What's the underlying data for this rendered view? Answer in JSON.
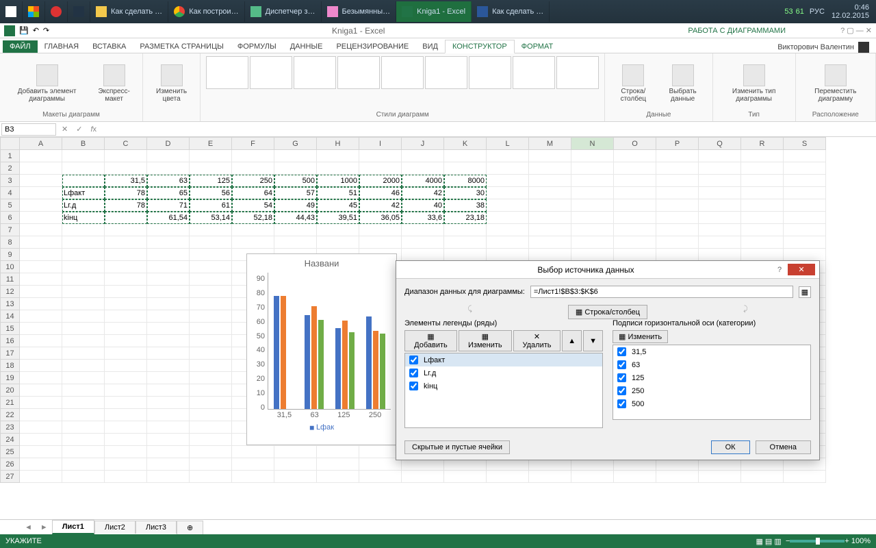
{
  "taskbar": {
    "items": [
      {
        "label": "",
        "icon": "start"
      },
      {
        "label": "",
        "icon": "apps"
      },
      {
        "label": "",
        "icon": "opera"
      },
      {
        "label": "",
        "icon": "xmplay"
      },
      {
        "label": "Как сделать …",
        "icon": "folder"
      },
      {
        "label": "Как построи…",
        "icon": "chrome"
      },
      {
        "label": "Диспетчер з…",
        "icon": "taskmgr"
      },
      {
        "label": "Безымянны…",
        "icon": "paint"
      },
      {
        "label": "Kniga1 - Excel",
        "icon": "excel",
        "active": true
      },
      {
        "label": "Как сделать …",
        "icon": "word"
      }
    ],
    "tray": {
      "battery": "53",
      "signal": "61",
      "lang": "РУС",
      "time": "0:46",
      "date": "12.02.2015"
    }
  },
  "qat": {
    "title": "Kniga1 - Excel",
    "context": "РАБОТА С ДИАГРАММАМИ"
  },
  "tabs": {
    "file": "ФАЙЛ",
    "items": [
      "ГЛАВНАЯ",
      "ВСТАВКА",
      "РАЗМЕТКА СТРАНИЦЫ",
      "ФОРМУЛЫ",
      "ДАННЫЕ",
      "РЕЦЕНЗИРОВАНИЕ",
      "ВИД"
    ],
    "ctx": [
      "КОНСТРУКТОР",
      "ФОРМАТ"
    ],
    "active": "КОНСТРУКТОР",
    "user": "Викторович Валентин"
  },
  "ribbon": {
    "g1": {
      "label": "Макеты диаграмм",
      "b1": "Добавить элемент диаграммы",
      "b2": "Экспресс-макет"
    },
    "g2": {
      "label": "",
      "b1": "Изменить цвета"
    },
    "g3": {
      "label": "Стили диаграмм"
    },
    "g4": {
      "label": "Данные",
      "b1": "Строка/столбец",
      "b2": "Выбрать данные"
    },
    "g5": {
      "label": "Тип",
      "b1": "Изменить тип диаграммы"
    },
    "g6": {
      "label": "Расположение",
      "b1": "Переместить диаграмму"
    }
  },
  "namebox": "B3",
  "sheet": {
    "cols": [
      "A",
      "B",
      "C",
      "D",
      "E",
      "F",
      "G",
      "H",
      "I",
      "J",
      "K",
      "L",
      "M",
      "N",
      "O",
      "P",
      "Q",
      "R",
      "S"
    ],
    "rowlabels": [
      "Lфакт",
      "Lг.д",
      "kінц"
    ],
    "r3": [
      "",
      "",
      "31,5",
      "63",
      "125",
      "250",
      "500",
      "1000",
      "2000",
      "4000",
      "8000"
    ],
    "r4": [
      "",
      "Lфакт",
      "78",
      "65",
      "56",
      "64",
      "57",
      "51",
      "46",
      "42",
      "30"
    ],
    "r5": [
      "",
      "Lг.д",
      "78",
      "71",
      "61",
      "54",
      "49",
      "45",
      "42",
      "40",
      "38"
    ],
    "r6": [
      "",
      "kінц",
      "",
      "61,54",
      "53,14",
      "52,18",
      "44,43",
      "39,51",
      "36,05",
      "33,6",
      "23,18"
    ]
  },
  "chart_data": {
    "type": "bar",
    "title": "Названи",
    "categories": [
      "31,5",
      "63",
      "125",
      "250"
    ],
    "series": [
      {
        "name": "Lфакт",
        "values": [
          78,
          65,
          56,
          64
        ]
      },
      {
        "name": "Lг.д",
        "values": [
          78,
          71,
          61,
          54
        ]
      },
      {
        "name": "kінц",
        "values": [
          0,
          61.54,
          53.14,
          52.18
        ]
      }
    ],
    "ylim": [
      0,
      90
    ],
    "yticks": [
      0,
      10,
      20,
      30,
      40,
      50,
      60,
      70,
      80,
      90
    ],
    "legend": "Lфак"
  },
  "dialog": {
    "title": "Выбор источника данных",
    "range_label": "Диапазон данных для диаграммы:",
    "range_value": "=Лист1!$B$3:$K$6",
    "rowcol": "Строка/столбец",
    "legend_label": "Элементы легенды (ряды)",
    "axis_label": "Подписи горизонтальной оси (категории)",
    "add": "Добавить",
    "edit": "Изменить",
    "del": "Удалить",
    "edit2": "Изменить",
    "series": [
      "Lфакт",
      "Lг.д",
      "kінц"
    ],
    "cats": [
      "31,5",
      "63",
      "125",
      "250",
      "500"
    ],
    "hidden": "Скрытые и пустые ячейки",
    "ok": "ОК",
    "cancel": "Отмена"
  },
  "sheets": [
    "Лист1",
    "Лист2",
    "Лист3"
  ],
  "status": {
    "mode": "УКАЖИТЕ",
    "zoom": "100%"
  }
}
